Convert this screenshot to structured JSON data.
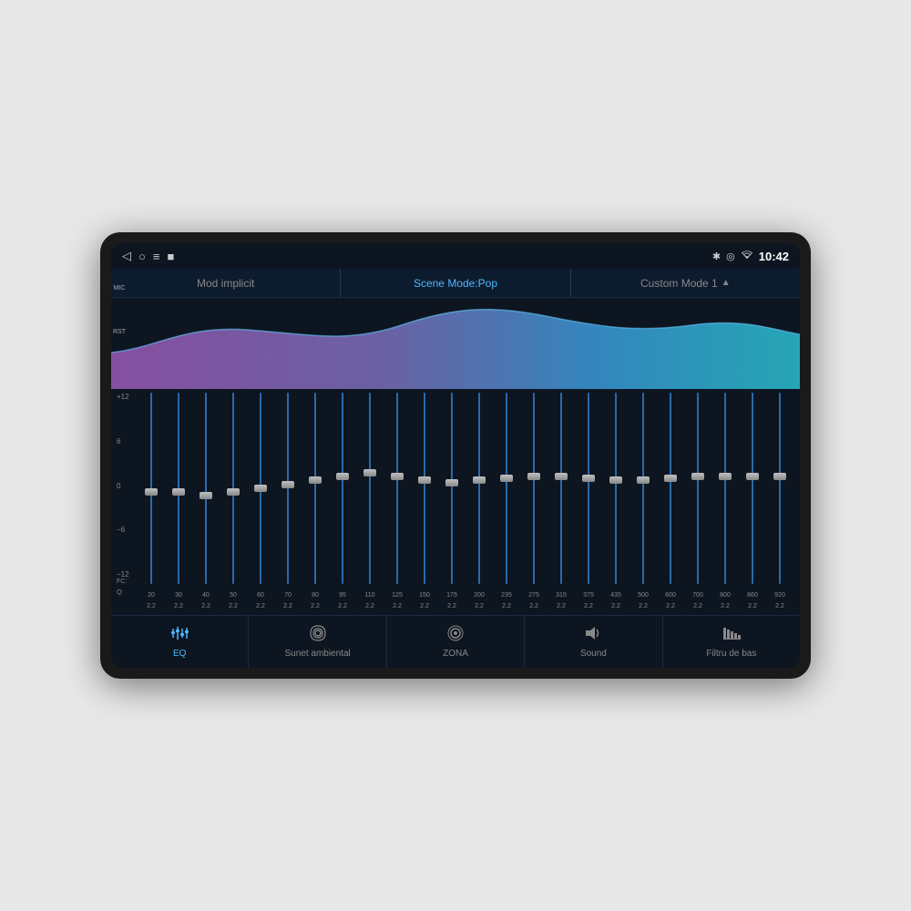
{
  "device": {
    "screen_bg": "#0d1520"
  },
  "status_bar": {
    "mic_label": "MIC",
    "rst_label": "RST",
    "nav_back": "◁",
    "nav_circle": "○",
    "nav_menu": "≡",
    "nav_square": "■",
    "icon_bluetooth": "✱",
    "icon_location": "◎",
    "icon_wifi": "▲",
    "icon_signal": "▲",
    "time": "10:42"
  },
  "mode_bar": {
    "items": [
      {
        "label": "Mod implicit",
        "active": false
      },
      {
        "label": "Scene Mode:Pop",
        "active": true
      },
      {
        "label": "Custom Mode 1",
        "active": false,
        "has_arrow": true
      }
    ]
  },
  "eq_sliders": {
    "scale": [
      "+12",
      "6",
      "0",
      "−6",
      "−12"
    ],
    "freq_header": "FC:\nQ:",
    "bands": [
      {
        "freq": "20",
        "q": "2.2",
        "pos": 50
      },
      {
        "freq": "30",
        "q": "2.2",
        "pos": 50
      },
      {
        "freq": "40",
        "q": "2.2",
        "pos": 52
      },
      {
        "freq": "50",
        "q": "2.2",
        "pos": 50
      },
      {
        "freq": "60",
        "q": "2.2",
        "pos": 48
      },
      {
        "freq": "70",
        "q": "2.2",
        "pos": 46
      },
      {
        "freq": "80",
        "q": "2.2",
        "pos": 44
      },
      {
        "freq": "95",
        "q": "2.2",
        "pos": 42
      },
      {
        "freq": "110",
        "q": "2.2",
        "pos": 40
      },
      {
        "freq": "125",
        "q": "2.2",
        "pos": 42
      },
      {
        "freq": "150",
        "q": "2.2",
        "pos": 44
      },
      {
        "freq": "175",
        "q": "2.2",
        "pos": 45
      },
      {
        "freq": "200",
        "q": "2.2",
        "pos": 44
      },
      {
        "freq": "235",
        "q": "2.2",
        "pos": 43
      },
      {
        "freq": "275",
        "q": "2.2",
        "pos": 42
      },
      {
        "freq": "315",
        "q": "2.2",
        "pos": 42
      },
      {
        "freq": "375",
        "q": "2.2",
        "pos": 43
      },
      {
        "freq": "435",
        "q": "2.2",
        "pos": 44
      },
      {
        "freq": "500",
        "q": "2.2",
        "pos": 44
      },
      {
        "freq": "600",
        "q": "2.2",
        "pos": 43
      },
      {
        "freq": "700",
        "q": "2.2",
        "pos": 42
      },
      {
        "freq": "800",
        "q": "2.2",
        "pos": 42
      },
      {
        "freq": "860",
        "q": "2.2",
        "pos": 42
      },
      {
        "freq": "920",
        "q": "2.2",
        "pos": 42
      }
    ]
  },
  "bottom_nav": {
    "tabs": [
      {
        "id": "eq",
        "icon": "⚙",
        "label": "EQ",
        "active": true,
        "icon_type": "sliders"
      },
      {
        "id": "ambient",
        "icon": "◉",
        "label": "Sunet ambiental",
        "active": false,
        "icon_type": "waves"
      },
      {
        "id": "zone",
        "icon": "◎",
        "label": "ZONA",
        "active": false,
        "icon_type": "circle-dot"
      },
      {
        "id": "sound",
        "icon": "🔈",
        "label": "Sound",
        "active": false,
        "icon_type": "speaker"
      },
      {
        "id": "bass",
        "icon": "▦",
        "label": "Filtru de bas",
        "active": false,
        "icon_type": "filter"
      }
    ]
  }
}
